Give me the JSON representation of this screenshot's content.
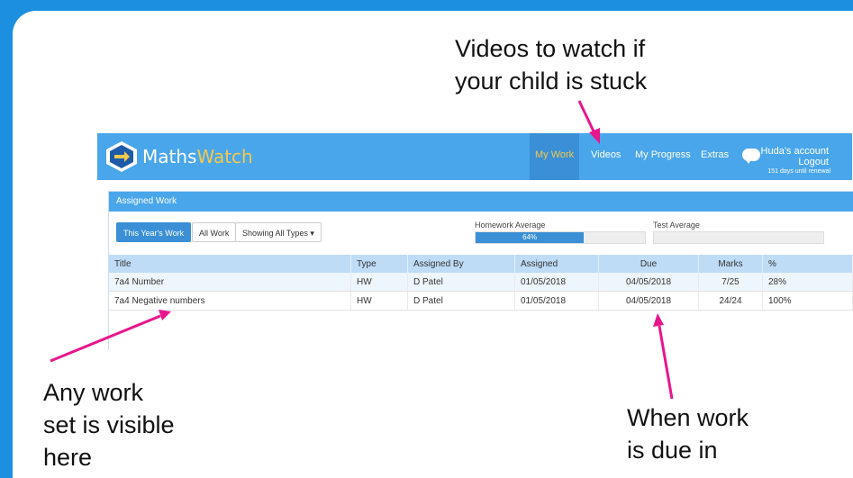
{
  "annotations": {
    "videos": "Videos to watch if\nyour child is stuck",
    "work": "Any work\nset is visible\nhere",
    "due": "When work\nis due in"
  },
  "app": {
    "brand_part1": "Maths",
    "brand_part2": "Watch",
    "nav": [
      "My Work",
      "Videos",
      "My Progress",
      "Extras"
    ],
    "account": "Huda's account",
    "logout": "Logout",
    "renewal": "151 days until renewal"
  },
  "panel": {
    "title": "Assigned Work",
    "filter_buttons": [
      "This Year's Work",
      "All Work",
      "Showing All Types ▾"
    ],
    "homework_average_label": "Homework Average",
    "homework_average_value": "64%",
    "homework_average_fraction": 0.64,
    "test_average_label": "Test Average"
  },
  "table": {
    "headers": [
      "Title",
      "Type",
      "Assigned By",
      "Assigned",
      "Due",
      "Marks",
      "%"
    ],
    "rows": [
      [
        "7a4 Number",
        "HW",
        "D Patel",
        "01/05/2018",
        "04/05/2018",
        "7/25",
        "28%"
      ],
      [
        "7a4 Negative numbers",
        "HW",
        "D Patel",
        "01/05/2018",
        "04/05/2018",
        "24/24",
        "100%"
      ]
    ]
  },
  "colors": {
    "background": "#1c8fe0",
    "topbar": "#4aa6ea",
    "active_nav": "#f2c94c",
    "arrow": "#e8168c"
  }
}
